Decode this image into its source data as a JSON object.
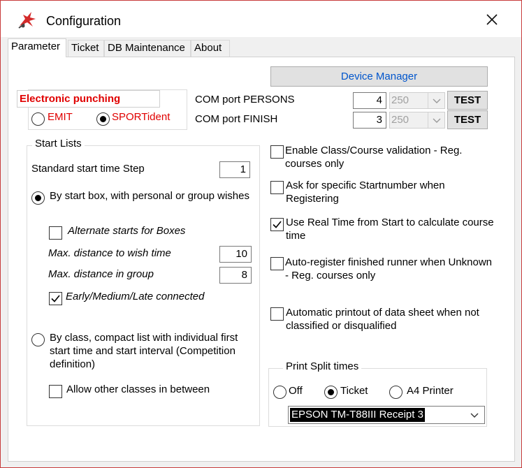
{
  "window": {
    "title": "Configuration",
    "icon": "app-logo-icon",
    "close_icon": "close-icon"
  },
  "tabs": [
    {
      "label": "Parameter",
      "active": true
    },
    {
      "label": "Ticket",
      "active": false
    },
    {
      "label": "DB Maintenance",
      "active": false
    },
    {
      "label": "About",
      "active": false
    }
  ],
  "device_manager": {
    "label": "Device Manager"
  },
  "punching": {
    "title": "Electronic punching",
    "options": [
      {
        "label": "EMIT",
        "selected": false
      },
      {
        "label": "SPORTident",
        "selected": true
      }
    ]
  },
  "com_ports": [
    {
      "label": "COM port PERSONS",
      "port": "4",
      "baud": "250",
      "test_label": "TEST"
    },
    {
      "label": "COM port FINISH",
      "port": "3",
      "baud": "250",
      "test_label": "TEST"
    }
  ],
  "start_lists": {
    "title": "Start Lists",
    "step_label": "Standard start time Step",
    "step_value": "1",
    "by_box": {
      "label": "By start box, with personal or group wishes",
      "selected": true,
      "alternate_label": "Alternate starts for Boxes",
      "alternate_checked": false,
      "max_wish_label": "Max. distance to wish time",
      "max_wish_value": "10",
      "max_group_label": "Max. distance in group",
      "max_group_value": "8",
      "early_label": "Early/Medium/Late connected",
      "early_checked": true
    },
    "by_class": {
      "label": "By class, compact list with individual first start time and start interval (Competition definition)",
      "selected": false,
      "allow_label": "Allow other classes in between",
      "allow_checked": false
    }
  },
  "options": [
    {
      "label": "Enable Class/Course validation - Reg. courses only",
      "checked": false
    },
    {
      "label": "Ask for specific Startnumber when Registering",
      "checked": false
    },
    {
      "label": "Use Real Time from Start to calculate course time",
      "checked": true
    },
    {
      "label": "Auto-register finished runner when Unknown - Reg. courses only",
      "checked": false
    },
    {
      "label": "Automatic printout of data sheet when not classified or disqualified",
      "checked": false
    }
  ],
  "print_split": {
    "title": "Print Split times",
    "options": [
      {
        "label": "Off",
        "selected": false
      },
      {
        "label": "Ticket",
        "selected": true
      },
      {
        "label": "A4 Printer",
        "selected": false
      }
    ],
    "printer": "EPSON TM-T88III Receipt 3"
  }
}
